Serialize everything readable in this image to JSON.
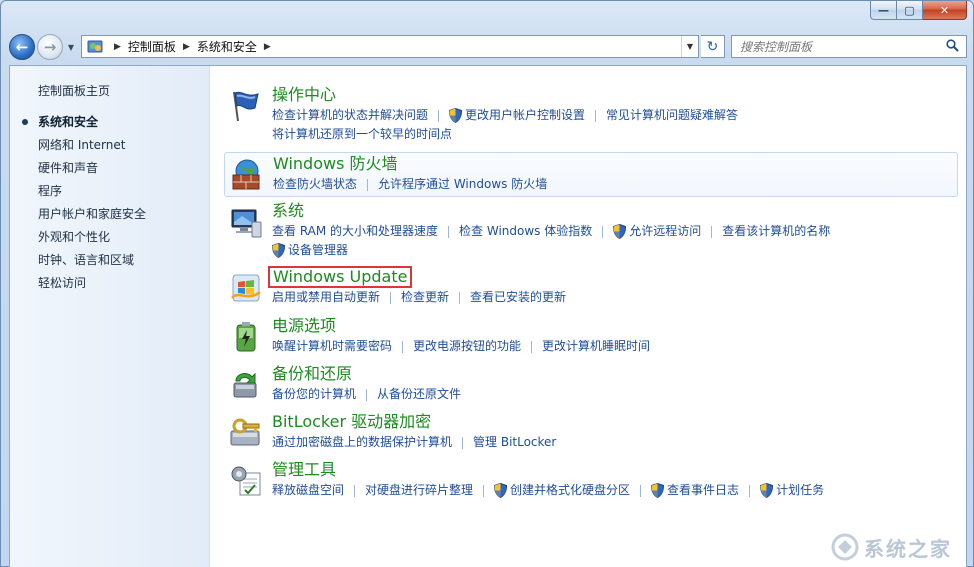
{
  "window": {
    "min_label": "—",
    "max_label": "▢",
    "close_label": "✕"
  },
  "address": {
    "crumbs": [
      "控制面板",
      "系统和安全"
    ]
  },
  "search": {
    "placeholder": "搜索控制面板"
  },
  "sidebar": {
    "home": "控制面板主页",
    "items": [
      {
        "label": "系统和安全",
        "active": true
      },
      {
        "label": "网络和 Internet"
      },
      {
        "label": "硬件和声音"
      },
      {
        "label": "程序"
      },
      {
        "label": "用户帐户和家庭安全"
      },
      {
        "label": "外观和个性化"
      },
      {
        "label": "时钟、语言和区域"
      },
      {
        "label": "轻松访问"
      }
    ]
  },
  "categories": [
    {
      "title": "操作中心",
      "icon": "flag-icon",
      "lines": [
        [
          {
            "label": "检查计算机的状态并解决问题"
          },
          {
            "label": "更改用户帐户控制设置",
            "shield": true
          },
          {
            "label": "常见计算机问题疑难解答"
          }
        ],
        [
          {
            "label": "将计算机还原到一个较早的时间点"
          }
        ]
      ]
    },
    {
      "title": "Windows 防火墙",
      "icon": "firewall-icon",
      "lines": [
        [
          {
            "label": "检查防火墙状态"
          },
          {
            "label": "允许程序通过 Windows 防火墙"
          }
        ]
      ]
    },
    {
      "title": "系统",
      "icon": "system-icon",
      "lines": [
        [
          {
            "label": "查看 RAM 的大小和处理器速度"
          },
          {
            "label": "检查 Windows 体验指数"
          },
          {
            "label": "允许远程访问",
            "shield": true
          },
          {
            "label": "查看该计算机的名称"
          }
        ],
        [
          {
            "label": "设备管理器",
            "shield": true
          }
        ]
      ]
    },
    {
      "title": "Windows Update",
      "icon": "windows-update-icon",
      "lines": [
        [
          {
            "label": "启用或禁用自动更新"
          },
          {
            "label": "检查更新"
          },
          {
            "label": "查看已安装的更新"
          }
        ]
      ]
    },
    {
      "title": "电源选项",
      "icon": "power-options-icon",
      "lines": [
        [
          {
            "label": "唤醒计算机时需要密码"
          },
          {
            "label": "更改电源按钮的功能"
          },
          {
            "label": "更改计算机睡眠时间"
          }
        ]
      ]
    },
    {
      "title": "备份和还原",
      "icon": "backup-restore-icon",
      "lines": [
        [
          {
            "label": "备份您的计算机"
          },
          {
            "label": "从备份还原文件"
          }
        ]
      ]
    },
    {
      "title": "BitLocker 驱动器加密",
      "icon": "bitlocker-icon",
      "lines": [
        [
          {
            "label": "通过加密磁盘上的数据保护计算机"
          },
          {
            "label": "管理 BitLocker"
          }
        ]
      ]
    },
    {
      "title": "管理工具",
      "icon": "admin-tools-icon",
      "lines": [
        [
          {
            "label": "释放磁盘空间"
          },
          {
            "label": "对硬盘进行碎片整理"
          },
          {
            "label": "创建并格式化硬盘分区",
            "shield": true
          },
          {
            "label": "查看事件日志",
            "shield": true
          },
          {
            "label": "计划任务",
            "shield": true
          }
        ]
      ]
    }
  ],
  "watermark": "系统之家",
  "colors": {
    "category_title": "#1e8a20",
    "link": "#1f4d96",
    "highlight_box": "#e0333a"
  }
}
